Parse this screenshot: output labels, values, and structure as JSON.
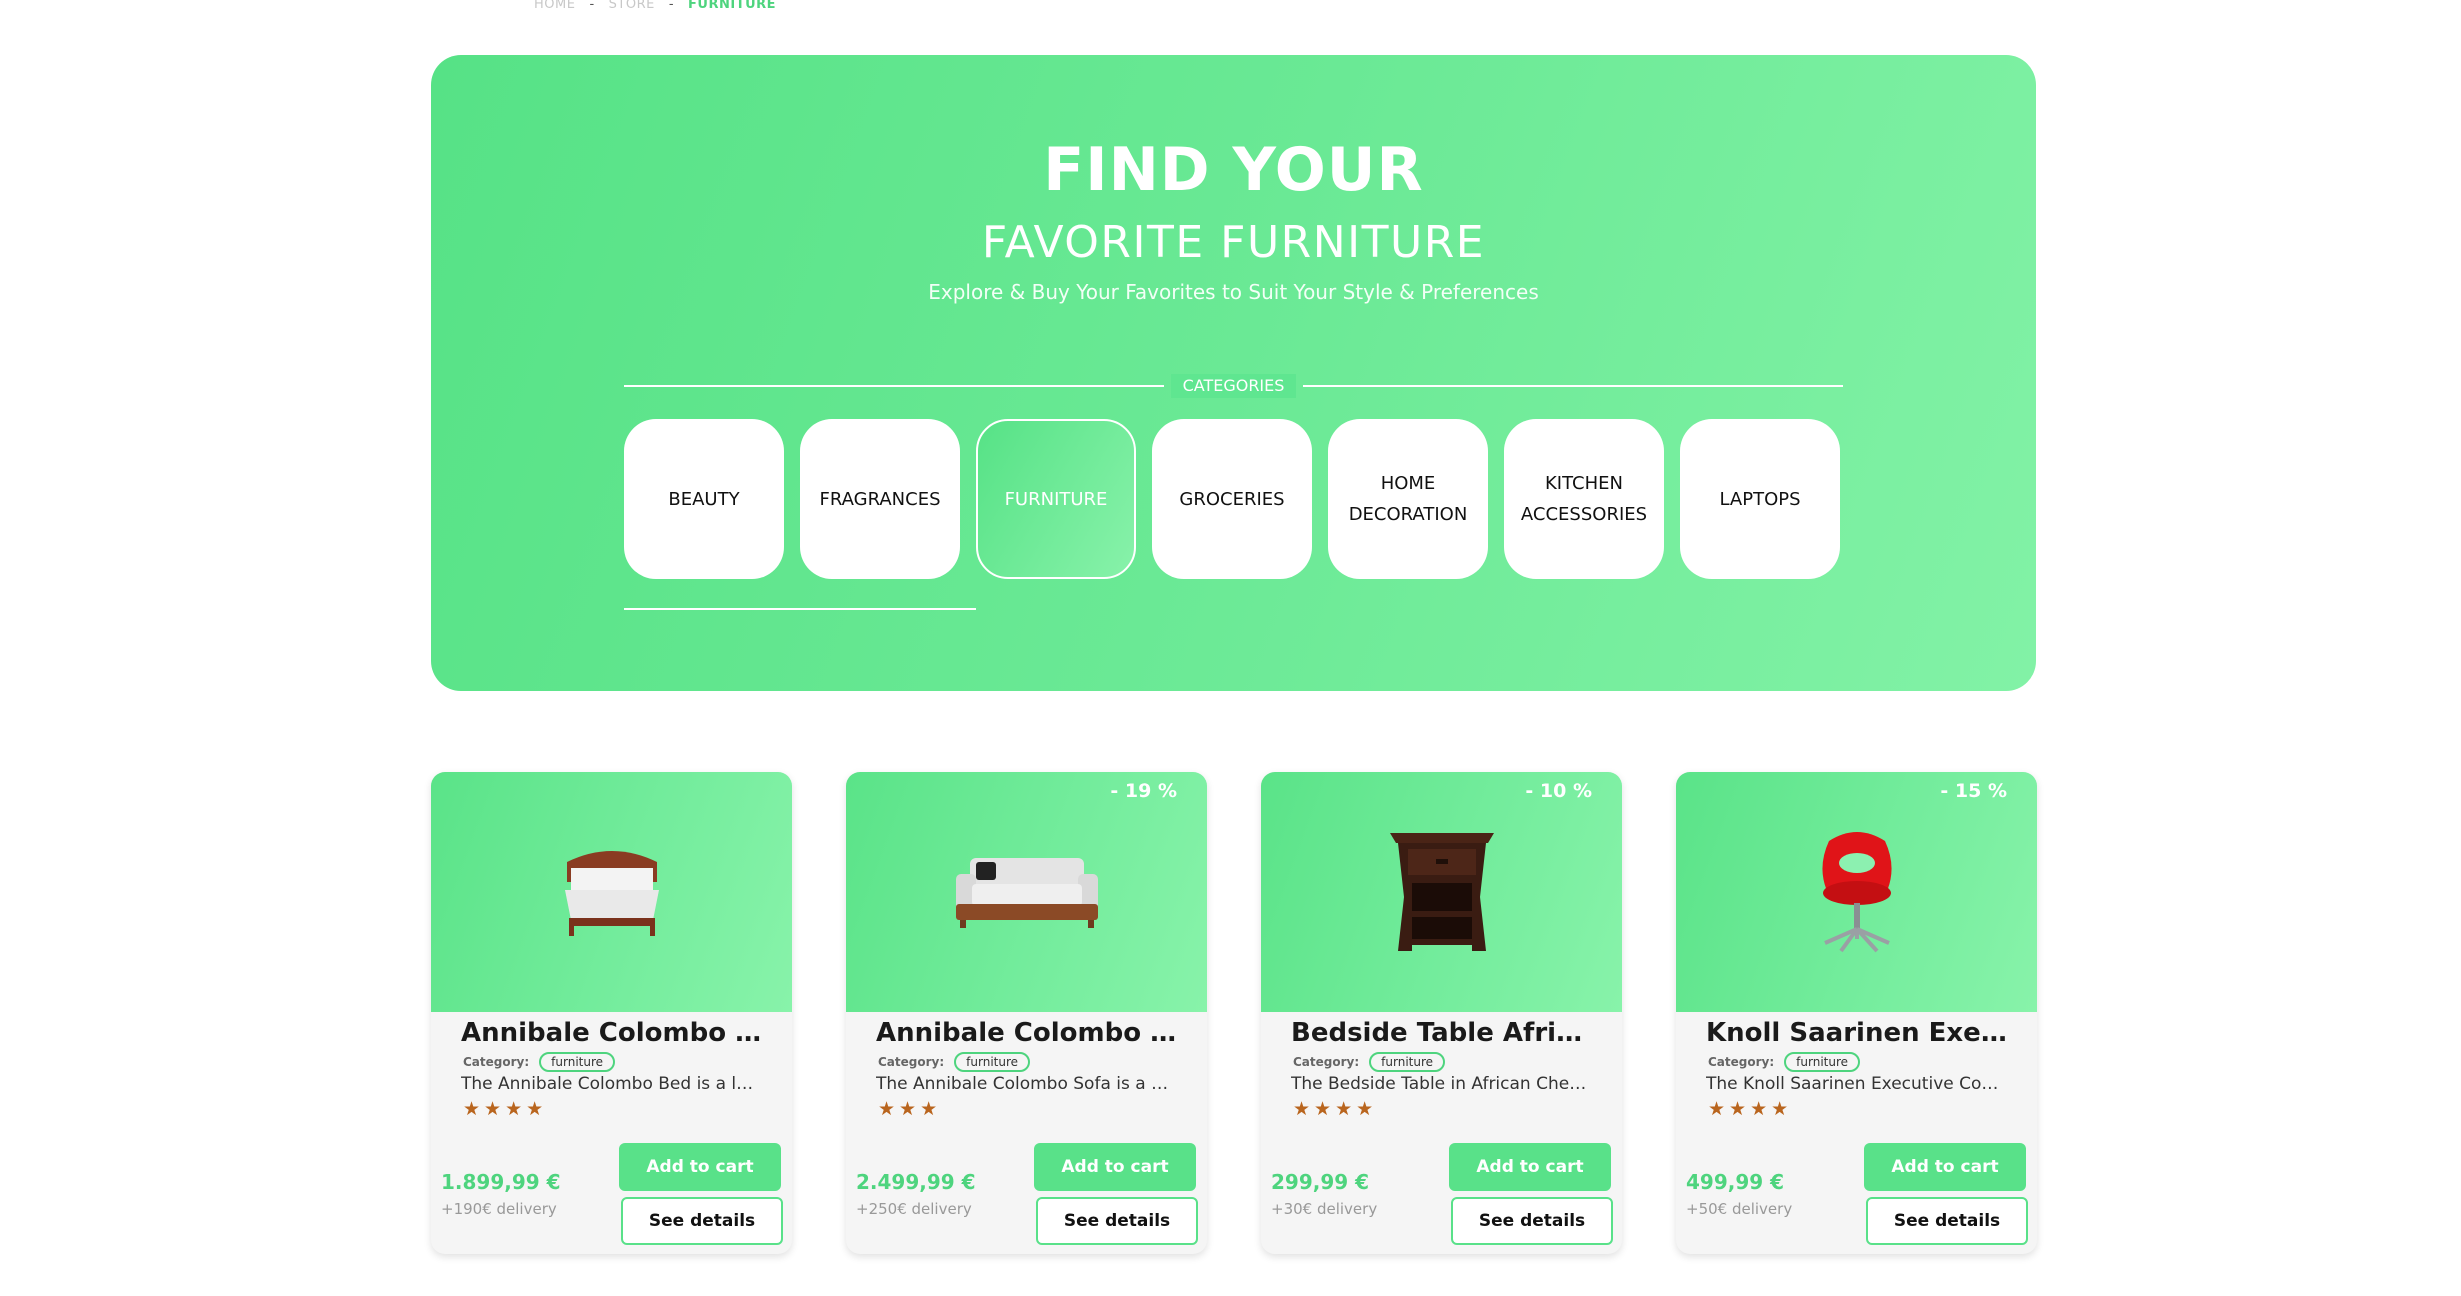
{
  "breadcrumb": {
    "home": "HOME",
    "store": "STORE",
    "current": "FURNITURE",
    "separator": "-"
  },
  "hero": {
    "title_line1": "FIND YOUR",
    "title_line2": "FAVORITE FURNITURE",
    "subtitle": "Explore & Buy Your Favorites to Suit Your Style & Preferences",
    "categories_heading": "CATEGORIES",
    "categories": [
      "BEAUTY",
      "FRAGRANCES",
      "FURNITURE",
      "GROCERIES",
      "HOME DECORATION",
      "KITCHEN ACCESSORIES",
      "LAPTOPS"
    ],
    "active_category": "FURNITURE"
  },
  "products": [
    {
      "title": "Annibale Colombo Bed",
      "category_label": "Category:",
      "category": "furniture",
      "description": "The Annibale Colombo Bed is a luxurious and elegant bed frame",
      "stars": "★★★★",
      "price": "1.899,99 €",
      "delivery": "+190€ delivery",
      "discount": "",
      "image_icon": "bed-icon",
      "add_label": "Add to cart",
      "details_label": "See details"
    },
    {
      "title": "Annibale Colombo Sofa",
      "category_label": "Category:",
      "category": "furniture",
      "description": "The Annibale Colombo Sofa is a sophisticated and comfortable seating option",
      "stars": "★★★",
      "price": "2.499,99 €",
      "delivery": "+250€ delivery",
      "discount": "- 19 %",
      "image_icon": "sofa-icon",
      "add_label": "Add to cart",
      "details_label": "See details"
    },
    {
      "title": "Bedside Table African Cherry",
      "category_label": "Category:",
      "category": "furniture",
      "description": "The Bedside Table in African Cherry is a stylish and functional addition",
      "stars": "★★★★",
      "price": "299,99 €",
      "delivery": "+30€ delivery",
      "discount": "- 10 %",
      "image_icon": "bedside-table-icon",
      "add_label": "Add to cart",
      "details_label": "See details"
    },
    {
      "title": "Knoll Saarinen Executive Conference Chair",
      "category_label": "Category:",
      "category": "furniture",
      "description": "The Knoll Saarinen Executive Conference Chair is a modern and ergonomic chair",
      "stars": "★★★★",
      "price": "499,99 €",
      "delivery": "+50€ delivery",
      "discount": "- 15 %",
      "image_icon": "office-chair-icon",
      "add_label": "Add to cart",
      "details_label": "See details"
    }
  ],
  "colors": {
    "accent": "#59e189",
    "star": "#b9651e"
  }
}
